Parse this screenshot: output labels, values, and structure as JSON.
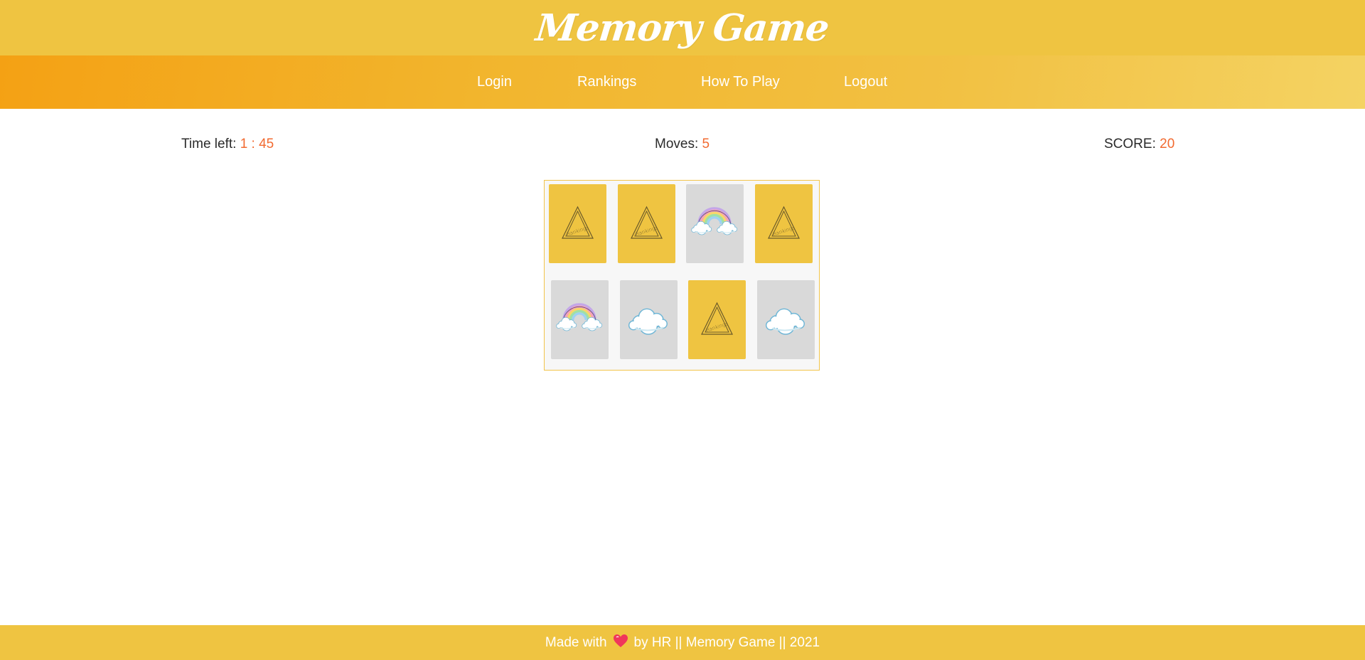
{
  "header": {
    "title": "Memory Game"
  },
  "nav": {
    "items": [
      {
        "label": "Login"
      },
      {
        "label": "Rankings"
      },
      {
        "label": "How To Play"
      },
      {
        "label": "Logout"
      }
    ]
  },
  "stats": {
    "time_label": "Time left:",
    "time_value": "1 : 45",
    "moves_label": "Moves:",
    "moves_value": "5",
    "score_label": "SCORE:",
    "score_value": "20"
  },
  "board": {
    "card_back_text": "Rankings",
    "rows": [
      [
        "back",
        "back",
        "rainbow-icon",
        "back"
      ],
      [
        "rainbow-icon",
        "cloud-icon",
        "back",
        "cloud-icon"
      ]
    ]
  },
  "footer": {
    "made_with": "Made with",
    "rest": "by HR || Memory Game || 2021"
  },
  "colors": {
    "accent": "#efc441",
    "value_highlight": "#f26a30",
    "card_face_up": "#d9d9d9",
    "heart": "#f0365b"
  }
}
